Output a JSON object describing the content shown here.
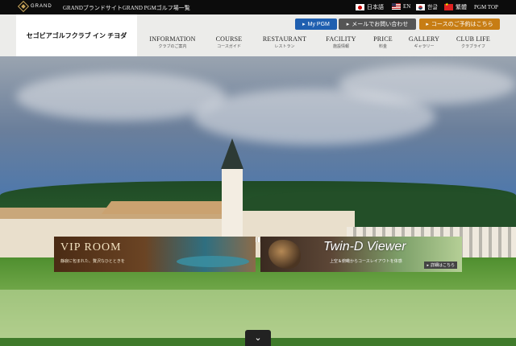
{
  "topbar": {
    "brand": "GRAND",
    "links": [
      "GRANDブランドサイト",
      "GRAND PGMゴルフ場一覧"
    ],
    "languages": [
      {
        "label": "日本語",
        "flag": "jp-flag"
      },
      {
        "label": "EN",
        "flag": "us-flag"
      },
      {
        "label": "한글",
        "flag": "kr-flag"
      },
      {
        "label": "繁體",
        "flag": "cn-flag"
      }
    ],
    "pgm_top": "PGM TOP"
  },
  "header": {
    "logo_text": "セゴビアゴルフクラブ イン チヨダ",
    "buttons": {
      "mypgm": "My PGM",
      "contact": "メールでお問い合わせ",
      "reserve": "コースのご予約はこちら"
    }
  },
  "nav": [
    {
      "en": "INFORMATION",
      "ja": "クラブのご案内"
    },
    {
      "en": "COURSE",
      "ja": "コースガイド"
    },
    {
      "en": "RESTAURANT",
      "ja": "レストラン"
    },
    {
      "en": "FACILITY",
      "ja": "施設情報"
    },
    {
      "en": "PRICE",
      "ja": "料金"
    },
    {
      "en": "GALLERY",
      "ja": "ギャラリー"
    },
    {
      "en": "CLUB LIFE",
      "ja": "クラブライフ"
    }
  ],
  "banners": {
    "vip": {
      "title": "VIP ROOM",
      "subtitle": "静寂に包まれた、贅沢なひとときを"
    },
    "twin": {
      "title": "Twin-D Viewer",
      "subtitle": "上空＆俯瞰からコースレイアウトを体感",
      "detail": "詳細はこちら"
    }
  },
  "scroll_icon": "chevron-down-icon",
  "colors": {
    "mypgm": "#1f5fb0",
    "contact": "#555555",
    "reserve": "#c77d14",
    "topbar": "#0c0c0c"
  }
}
